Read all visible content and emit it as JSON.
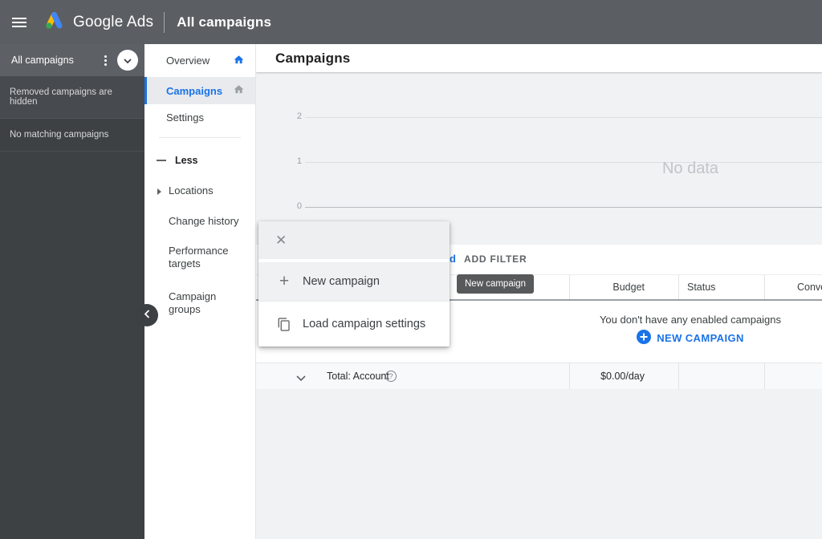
{
  "topbar": {
    "product": "Google Ads",
    "page_title": "All campaigns"
  },
  "sidebar": {
    "title": "All campaigns",
    "notices": [
      "Removed campaigns are hidden",
      "No matching campaigns"
    ]
  },
  "nav": {
    "items": [
      {
        "label": "Overview"
      },
      {
        "label": "Campaigns"
      },
      {
        "label": "Settings"
      },
      {
        "label": "Less"
      },
      {
        "label": "Locations"
      },
      {
        "label": "Change history"
      },
      {
        "label": "Performance targets"
      },
      {
        "label": "Campaign groups"
      }
    ]
  },
  "main": {
    "title": "Campaigns",
    "chart": {
      "y_ticks": [
        "2",
        "1",
        "0"
      ],
      "no_data_label": "No data"
    },
    "toolbar": {
      "filter_fragment": "d",
      "add_filter_label": "ADD FILTER"
    },
    "table": {
      "columns": [
        "Budget",
        "Status",
        "Conversions"
      ],
      "empty_message": "You don't have any enabled campaigns",
      "new_campaign_label": "NEW CAMPAIGN",
      "total_label": "Total: Account",
      "total_budget": "$0.00/day"
    }
  },
  "tooltip": {
    "text": "New campaign"
  },
  "menu": {
    "items": [
      {
        "label": "New campaign",
        "icon": "plus-icon"
      },
      {
        "label": "Load campaign settings",
        "icon": "copy-icon"
      }
    ]
  },
  "colors": {
    "accent": "#1a73e8",
    "topbar": "#5b5f63",
    "sidebar": "#3e4144",
    "logo_blue": "#4285f4",
    "logo_yellow": "#fbbc04",
    "logo_green": "#34a853"
  }
}
